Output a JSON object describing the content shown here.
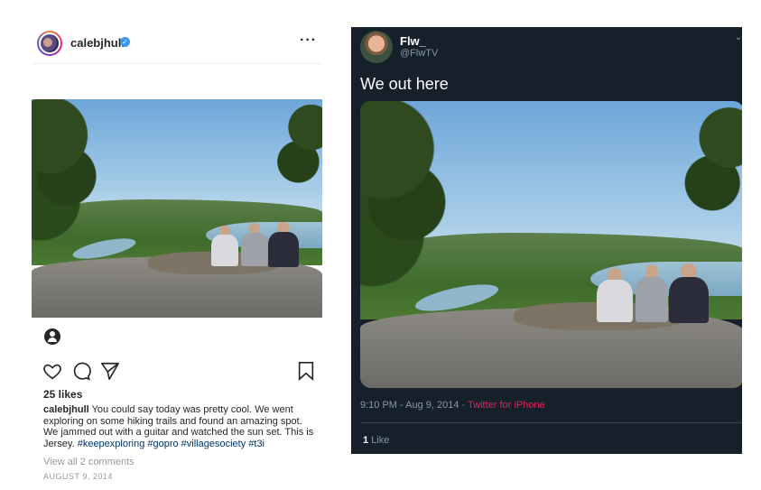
{
  "instagram": {
    "username": "calebjhull",
    "more_label": "···",
    "likes": "25 likes",
    "caption_user": "calebjhull",
    "caption_text": "You could say today was pretty cool.  We went exploring on some hiking trails and found an amazing spot. We jammed out with a guitar and watched the sun set. This is Jersey.",
    "caption_tags": "#keepexploring #gopro #villagesociety #t3i",
    "view_comments": "View all 2 comments",
    "date": "AUGUST 9, 2014",
    "icons": [
      "account-icon",
      "heart-icon",
      "comment-icon",
      "share-icon",
      "bookmark-icon",
      "verified-icon"
    ]
  },
  "twitter": {
    "name": "Flw_",
    "handle": "@FlwTV",
    "text": "We out here",
    "time": "9:10 PM - Aug 9, 2014",
    "separator": " · ",
    "source": "Twitter for iPhone",
    "like_count": "1",
    "like_label": "Like",
    "colors": {
      "background": "#15202b",
      "source": "#e0245e",
      "muted": "#8899a6"
    }
  }
}
